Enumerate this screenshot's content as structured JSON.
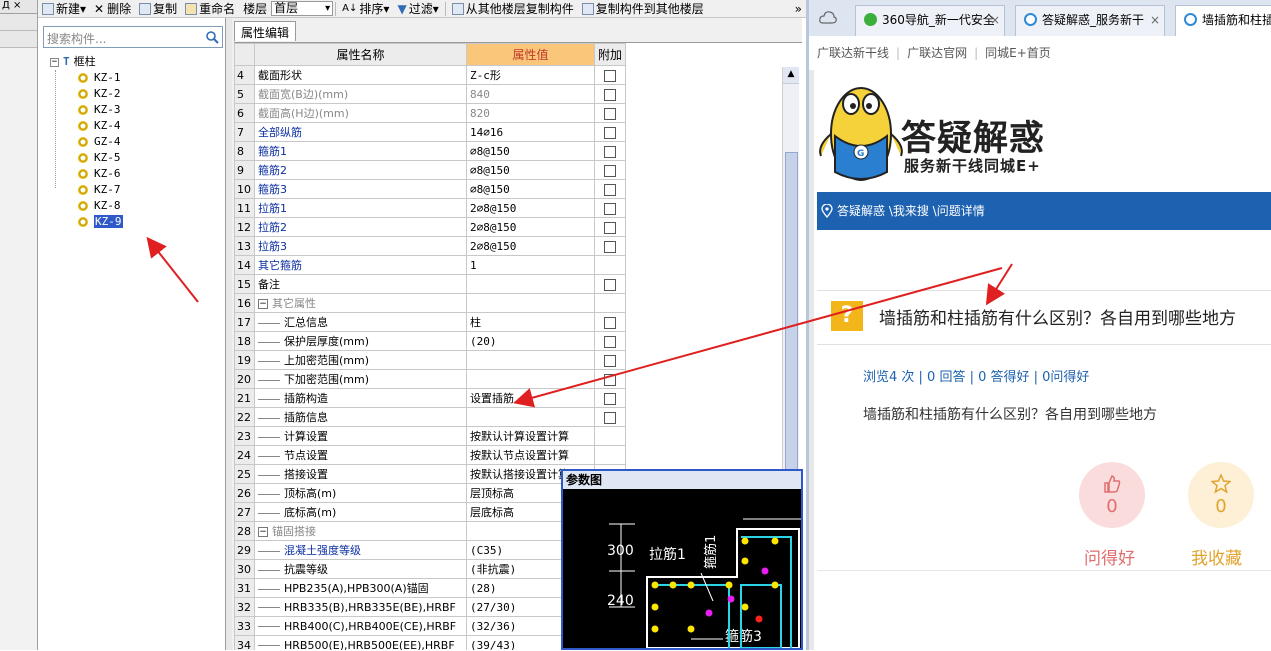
{
  "left_strip": {
    "top_label": "Д ⨯"
  },
  "toolbar": {
    "new_label": "新建",
    "delete_label": "删除",
    "copy_label": "复制",
    "rename_label": "重命名",
    "floor_label": "楼层",
    "floor_value": "首层",
    "sort_label": "排序",
    "filter_label": "过滤",
    "copy_from_label": "从其他楼层复制构件",
    "copy_to_label": "复制构件到其他楼层",
    "more_label": "»"
  },
  "tree_panel": {
    "search_placeholder": "搜索构件...",
    "root_label": "框柱",
    "items": [
      "KZ-1",
      "KZ-2",
      "KZ-3",
      "KZ-4",
      "GZ-4",
      "KZ-5",
      "KZ-6",
      "KZ-7",
      "KZ-8",
      "KZ-9"
    ],
    "selected_item": "KZ-9"
  },
  "properties": {
    "tab_label": "属性编辑",
    "headers": {
      "name": "属性名称",
      "value": "属性值",
      "add": "附加"
    },
    "rows": [
      {
        "num": "4",
        "name": "截面形状",
        "value": "Z-c形",
        "style": "",
        "cb": true
      },
      {
        "num": "5",
        "name": "截面宽(B边)(mm)",
        "value": "840",
        "style": "gray",
        "cb": true
      },
      {
        "num": "6",
        "name": "截面高(H边)(mm)",
        "value": "820",
        "style": "gray",
        "cb": true
      },
      {
        "num": "7",
        "name": "全部纵筋",
        "value": "14⌀16",
        "style": "blue",
        "cb": true
      },
      {
        "num": "8",
        "name": "箍筋1",
        "value": "⌀8@150",
        "style": "blue",
        "cb": true
      },
      {
        "num": "9",
        "name": "箍筋2",
        "value": "⌀8@150",
        "style": "blue",
        "cb": true
      },
      {
        "num": "10",
        "name": "箍筋3",
        "value": "⌀8@150",
        "style": "blue",
        "cb": true
      },
      {
        "num": "11",
        "name": "拉筋1",
        "value": "2⌀8@150",
        "style": "blue",
        "cb": true
      },
      {
        "num": "12",
        "name": "拉筋2",
        "value": "2⌀8@150",
        "style": "blue",
        "cb": true
      },
      {
        "num": "13",
        "name": "拉筋3",
        "value": "2⌀8@150",
        "style": "blue",
        "cb": true
      },
      {
        "num": "14",
        "name": "其它箍筋",
        "value": "1",
        "style": "blue",
        "cb": false
      },
      {
        "num": "15",
        "name": "备注",
        "value": "",
        "style": "",
        "cb": true
      },
      {
        "num": "16",
        "name": "其它属性",
        "value": "",
        "style": "group",
        "cb": false
      },
      {
        "num": "17",
        "name": "汇总信息",
        "value": "柱",
        "style": "child",
        "cb": true
      },
      {
        "num": "18",
        "name": "保护层厚度(mm)",
        "value": "(20)",
        "style": "child",
        "cb": true
      },
      {
        "num": "19",
        "name": "上加密范围(mm)",
        "value": "",
        "style": "child",
        "cb": true
      },
      {
        "num": "20",
        "name": "下加密范围(mm)",
        "value": "",
        "style": "child",
        "cb": true
      },
      {
        "num": "21",
        "name": "插筋构造",
        "value": "设置插筋",
        "style": "child",
        "cb": true
      },
      {
        "num": "22",
        "name": "插筋信息",
        "value": "",
        "style": "child",
        "cb": true
      },
      {
        "num": "23",
        "name": "计算设置",
        "value": "按默认计算设置计算",
        "style": "child",
        "cb": false
      },
      {
        "num": "24",
        "name": "节点设置",
        "value": "按默认节点设置计算",
        "style": "child",
        "cb": false
      },
      {
        "num": "25",
        "name": "搭接设置",
        "value": "按默认搭接设置计算",
        "style": "child",
        "cb": false
      },
      {
        "num": "26",
        "name": "顶标高(m)",
        "value": "层顶标高",
        "style": "child",
        "cb": false
      },
      {
        "num": "27",
        "name": "底标高(m)",
        "value": "层底标高",
        "style": "child",
        "cb": false
      },
      {
        "num": "28",
        "name": "锚固搭接",
        "value": "",
        "style": "group",
        "cb": false
      },
      {
        "num": "29",
        "name": "混凝土强度等级",
        "value": "(C35)",
        "style": "childblue",
        "cb": false
      },
      {
        "num": "30",
        "name": "抗震等级",
        "value": "(非抗震)",
        "style": "child",
        "cb": false
      },
      {
        "num": "31",
        "name": "HPB235(A),HPB300(A)锚固",
        "value": "(28)",
        "style": "child",
        "cb": false
      },
      {
        "num": "32",
        "name": "HRB335(B),HRB335E(BE),HRBF",
        "value": "(27/30)",
        "style": "child",
        "cb": false
      },
      {
        "num": "33",
        "name": "HRB400(C),HRB400E(CE),HRBF",
        "value": "(32/36)",
        "style": "child",
        "cb": false
      },
      {
        "num": "34",
        "name": "HRB500(E),HRB500E(EE),HRBF",
        "value": "(39/43)",
        "style": "child",
        "cb": false
      }
    ]
  },
  "diagram": {
    "title": "参数图",
    "labels": {
      "dim1": "300",
      "dim2": "240",
      "tie1": "拉筋1",
      "stirrup1": "箍筋1",
      "stirrup3": "箍筋3"
    }
  },
  "browser": {
    "tabs": [
      {
        "label": "360导航_新一代安全",
        "close": "×"
      },
      {
        "label": "答疑解惑_服务新干",
        "close": "×"
      },
      {
        "label": "墙插筋和柱插",
        "close": ""
      }
    ],
    "links": [
      "广联达新干线",
      "广联达官网",
      "同城E+首页"
    ],
    "logo_title": "答疑解惑",
    "logo_sub": "服务新干线同城E+",
    "breadcrumb": "答疑解惑 \\我来搜 \\问题详情",
    "question_icon": "?",
    "question_title": "墙插筋和柱插筋有什么区别？各自用到哪些地方",
    "stats": "浏览4 次 | 0 回答 | 0 答得好 | 0问得好",
    "question_desc": "墙插筋和柱插筋有什么区别？各自用到哪些地方",
    "good_count": "0",
    "good_label": "问得好",
    "fav_count": "0",
    "fav_label": "我收藏"
  },
  "colors": {
    "accent_blue": "#1d62b0",
    "annotation_red": "#e02020",
    "header_orange": "#f9c67a"
  }
}
